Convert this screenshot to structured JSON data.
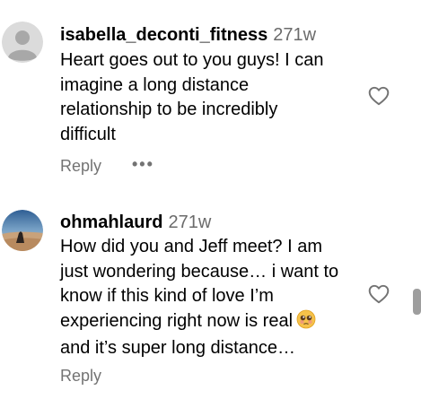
{
  "comments": [
    {
      "username": "isabella_deconti_fitness",
      "time": "271w",
      "lines": [
        "Heart goes out to you guys! I can",
        "imagine a long distance",
        "relationship to be incredibly",
        "difficult"
      ],
      "reply_label": "Reply",
      "more_label": "•••",
      "avatar": "default-avatar-icon"
    },
    {
      "username": "ohmahlaurd",
      "time": "271w",
      "lines": [
        "How did you and Jeff meet? I am",
        "just wondering because… i want to",
        "know if this kind of love I’m",
        "experiencing right now is real",
        "and it’s super long distance…"
      ],
      "reply_label": "Reply",
      "avatar": "desert-photo-avatar",
      "emoji": "pleading-face-emoji"
    }
  ],
  "icons": {
    "like": "heart-outline-icon"
  },
  "colors": {
    "text": "#000000",
    "secondary": "#737373",
    "timestamp": "#6b6b6b"
  }
}
